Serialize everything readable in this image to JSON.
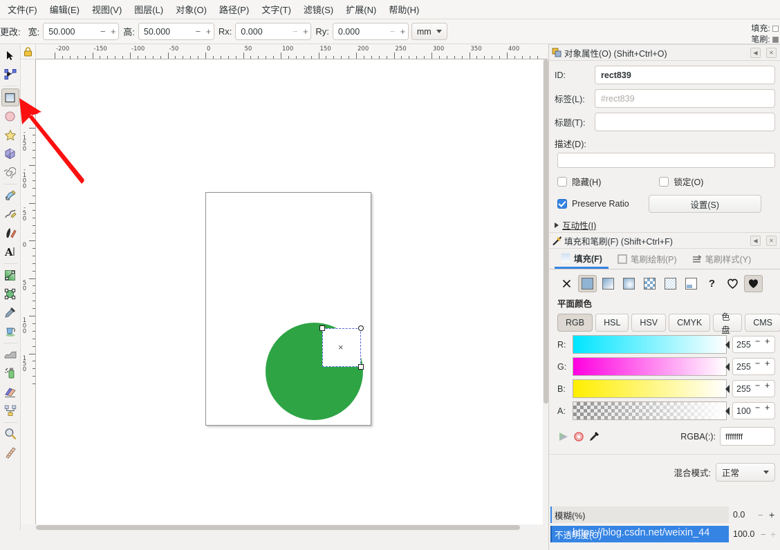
{
  "menubar": {
    "items": [
      {
        "label": "文件(F)",
        "name": "menu-file"
      },
      {
        "label": "编辑(E)",
        "name": "menu-edit"
      },
      {
        "label": "视图(V)",
        "name": "menu-view"
      },
      {
        "label": "图层(L)",
        "name": "menu-layer"
      },
      {
        "label": "对象(O)",
        "name": "menu-object"
      },
      {
        "label": "路径(P)",
        "name": "menu-path"
      },
      {
        "label": "文字(T)",
        "name": "menu-text"
      },
      {
        "label": "滤镜(S)",
        "name": "menu-filter"
      },
      {
        "label": "扩展(N)",
        "name": "menu-extension"
      },
      {
        "label": "帮助(H)",
        "name": "menu-help"
      }
    ]
  },
  "toolbar": {
    "change_label": "更改:",
    "width_label": "宽:",
    "width_value": "50.000",
    "height_label": "高:",
    "height_value": "50.000",
    "rx_label": "Rx:",
    "rx_value": "0.000",
    "ry_label": "Ry:",
    "ry_value": "0.000",
    "unit_value": "mm",
    "minus": "−",
    "plus": "+",
    "fill_label": "填充:",
    "stroke_label": "笔刷:"
  },
  "toolbox": {
    "tools": [
      {
        "name": "selector-tool",
        "title": "选择工具"
      },
      {
        "name": "node-tool",
        "title": "节点工具"
      },
      {
        "name": "rectangle-tool",
        "title": "矩形工具"
      },
      {
        "name": "ellipse-tool",
        "title": "椭圆工具"
      },
      {
        "name": "star-tool",
        "title": "星形工具"
      },
      {
        "name": "box3d-tool",
        "title": "3D 方框工具"
      },
      {
        "name": "spiral-tool",
        "title": "螺旋工具"
      },
      {
        "name": "pencil-tool",
        "title": "铅笔工具"
      },
      {
        "name": "bezier-tool",
        "title": "贝塞尔工具"
      },
      {
        "name": "calligraphy-tool",
        "title": "书法工具"
      },
      {
        "name": "text-tool",
        "title": "文本工具"
      },
      {
        "name": "gradient-tool",
        "title": "渐变工具"
      },
      {
        "name": "mesh-tool",
        "title": "网格工具"
      },
      {
        "name": "dropper-tool",
        "title": "滴管工具"
      },
      {
        "name": "paintbucket-tool",
        "title": "油漆桶工具"
      },
      {
        "name": "tweak-tool",
        "title": "微调工具"
      },
      {
        "name": "spray-tool",
        "title": "喷雾工具"
      },
      {
        "name": "eraser-tool",
        "title": "橡皮工具"
      },
      {
        "name": "connector-tool",
        "title": "连接线工具"
      },
      {
        "name": "zoom-tool",
        "title": "缩放工具"
      },
      {
        "name": "measure-tool",
        "title": "测量工具"
      }
    ]
  },
  "rulers": {
    "horizontal_ticks": [
      "-200",
      "-150",
      "-100",
      "-50",
      "0",
      "50",
      "100",
      "150",
      "200",
      "250",
      "300",
      "350",
      "400"
    ],
    "vertical_ticks": [
      "-150",
      "-100",
      "-50",
      "0",
      "50",
      "100",
      "150"
    ],
    "lock_icon": "lock-icon"
  },
  "canvas": {
    "shape_color": "#2ea444",
    "page_background": "#ffffff",
    "selection_marker": "×"
  },
  "object_properties": {
    "title": "对象属性(O) (Shift+Ctrl+O)",
    "id_label": "ID:",
    "id_value": "rect839",
    "tag_label": "标签(L):",
    "tag_placeholder": "#rect839",
    "title_label": "标题(T):",
    "title_value": "",
    "desc_label": "描述(D):",
    "desc_value": "",
    "hide_label": "隐藏(H)",
    "lock_label": "锁定(O)",
    "preserve_ratio_label": "Preserve Ratio",
    "set_button_label": "设置(S)",
    "interactivity_label": "互动性(I)"
  },
  "fill_stroke": {
    "title": "填充和笔刷(F) (Shift+Ctrl+F)",
    "tabs": [
      {
        "label": "填充(F)",
        "name": "tab-fill",
        "icon": "fill-swatch-icon",
        "active": true
      },
      {
        "label": "笔刷绘制(P)",
        "name": "tab-stroke-paint",
        "icon": "stroke-square-icon",
        "active": false
      },
      {
        "label": "笔刷样式(Y)",
        "name": "tab-stroke-style",
        "icon": "stroke-style-icon",
        "active": false
      }
    ],
    "paint_buttons": [
      {
        "name": "no-paint-button",
        "icon": "x-icon",
        "selected": false
      },
      {
        "name": "flat-color-button",
        "icon": "flat-color-icon",
        "selected": true
      },
      {
        "name": "linear-gradient-button",
        "icon": "linear-gradient-icon",
        "selected": false
      },
      {
        "name": "radial-gradient-button",
        "icon": "radial-gradient-icon",
        "selected": false
      },
      {
        "name": "pattern-button",
        "icon": "pattern-icon",
        "selected": false
      },
      {
        "name": "swatch-button",
        "icon": "swatch-icon",
        "selected": false
      },
      {
        "name": "mesh-gradient-button",
        "icon": "mesh-gradient-icon",
        "selected": false
      },
      {
        "name": "unknown-paint-button",
        "icon": "question-icon",
        "selected": false
      },
      {
        "name": "nonzero-fillrule-button",
        "icon": "fillrule-evenodd-icon",
        "selected": false
      },
      {
        "name": "evenodd-fillrule-button",
        "icon": "fillrule-nonzero-icon",
        "selected": true
      }
    ],
    "paint_mode_label": "平面颜色",
    "color_mode_tabs": [
      {
        "label": "RGB",
        "name": "colormode-rgb",
        "active": true
      },
      {
        "label": "HSL",
        "name": "colormode-hsl",
        "active": false
      },
      {
        "label": "HSV",
        "name": "colormode-hsv",
        "active": false
      },
      {
        "label": "CMYK",
        "name": "colormode-cmyk",
        "active": false
      },
      {
        "label": "色盘",
        "name": "colormode-wheel",
        "active": false
      },
      {
        "label": "CMS",
        "name": "colormode-cms",
        "active": false
      }
    ],
    "channels": [
      {
        "label": "R:",
        "value": "255",
        "name": "channel-r",
        "from": "#00e5ff",
        "to": "#ffffff"
      },
      {
        "label": "G:",
        "value": "255",
        "name": "channel-g",
        "from": "#ff00e0",
        "to": "#ffffff"
      },
      {
        "label": "B:",
        "value": "255",
        "name": "channel-b",
        "from": "#ffee00",
        "to": "#ffffff"
      },
      {
        "label": "A:",
        "value": "100",
        "name": "channel-a",
        "from": "checker",
        "to": "#ffffff"
      }
    ],
    "rgba_label": "RGBA(:):",
    "rgba_value": "ffffffff",
    "blend_label": "混合模式:",
    "blend_value": "正常",
    "blur_label": "模糊(%)",
    "blur_value": "0.0",
    "opacity_label": "不透明度(O)",
    "opacity_value": "100.0",
    "minus": "−",
    "plus": "+"
  },
  "watermark": {
    "text": "https://blog.csdn.net/weixin_44"
  }
}
